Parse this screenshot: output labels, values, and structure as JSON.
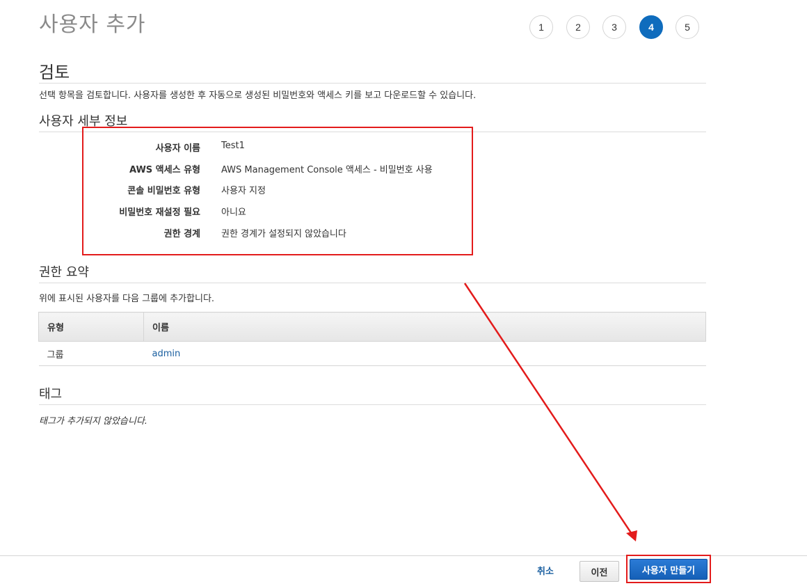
{
  "header": {
    "title": "사용자 추가"
  },
  "steps": [
    {
      "label": "1",
      "active": false
    },
    {
      "label": "2",
      "active": false
    },
    {
      "label": "3",
      "active": false
    },
    {
      "label": "4",
      "active": true
    },
    {
      "label": "5",
      "active": false
    }
  ],
  "review": {
    "title": "검토",
    "description": "선택 항목을 검토합니다. 사용자를 생성한 후 자동으로 생성된 비밀번호와 액세스 키를 보고 다운로드할 수 있습니다."
  },
  "user_details": {
    "title": "사용자 세부 정보",
    "rows": [
      {
        "label": "사용자 이름",
        "value": "Test1"
      },
      {
        "label": "AWS 액세스 유형",
        "value": "AWS Management Console 액세스 - 비밀번호 사용"
      },
      {
        "label": "콘솔 비밀번호 유형",
        "value": "사용자 지정"
      },
      {
        "label": "비밀번호 재설정 필요",
        "value": "아니요"
      },
      {
        "label": "권한 경계",
        "value": "권한 경계가 설정되지 않았습니다"
      }
    ]
  },
  "permissions": {
    "title": "권한 요약",
    "description": "위에 표시된 사용자를 다음 그룹에 추가합니다.",
    "columns": [
      "유형",
      "이름"
    ],
    "rows": [
      {
        "type": "그룹",
        "name": "admin"
      }
    ]
  },
  "tags": {
    "title": "태그",
    "empty_message": "태그가 추가되지 않았습니다."
  },
  "footer": {
    "cancel_label": "취소",
    "previous_label": "이전",
    "create_label": "사용자 만들기"
  },
  "colors": {
    "accent": "#0f6cbd",
    "link": "#1a5fa0",
    "highlight": "#e31b1b"
  }
}
